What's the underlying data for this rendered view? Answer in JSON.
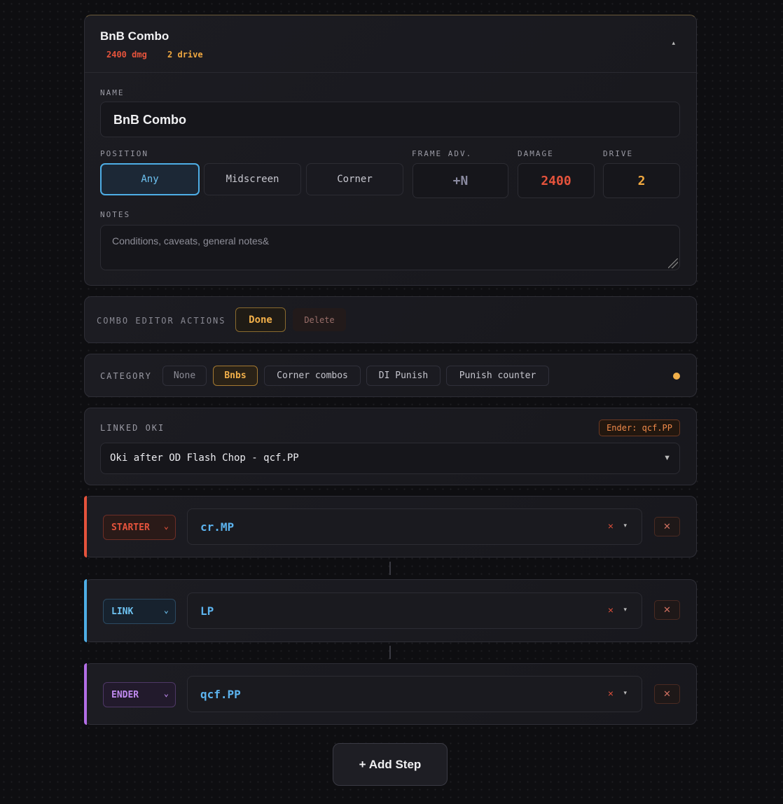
{
  "combo": {
    "title": "BnB Combo",
    "damage_stat": "2400 dmg",
    "drive_stat": "2 drive",
    "collapse_icon": "▴"
  },
  "form": {
    "name_label": "NAME",
    "name_value": "BnB Combo",
    "position_label": "POSITION",
    "positions": [
      "Any",
      "Midscreen",
      "Corner"
    ],
    "selected_position": "Any",
    "frame_adv_label": "FRAME ADV.",
    "frame_adv_value": "+N",
    "damage_label": "DAMAGE",
    "damage_value": "2400",
    "drive_label": "DRIVE",
    "drive_value": "2",
    "notes_label": "NOTES",
    "notes_placeholder": "Conditions, caveats, general notes&"
  },
  "actions": {
    "label": "COMBO EDITOR ACTIONS",
    "done": "Done",
    "delete": "Delete"
  },
  "category": {
    "label": "CATEGORY",
    "options": [
      "None",
      "Bnbs",
      "Corner combos",
      "DI Punish",
      "Punish counter"
    ],
    "selected": "Bnbs"
  },
  "oki": {
    "label": "LINKED OKI",
    "ender_badge": "Ender: qcf.PP",
    "selected": "Oki after OD Flash Chop - qcf.PP",
    "caret": "▼"
  },
  "steps": [
    {
      "type": "STARTER",
      "move": "cr.MP",
      "color": "#e5533c"
    },
    {
      "type": "LINK",
      "move": "LP",
      "color": "#4eaee6"
    },
    {
      "type": "ENDER",
      "move": "qcf.PP",
      "color": "#b36ee6"
    }
  ],
  "step_controls": {
    "chevron": "⌄",
    "clear": "×",
    "dropdown": "▾",
    "remove": "✕"
  },
  "add_step": "+ Add Step",
  "colors": {
    "accent": "#f2b04a",
    "danger": "#e5533c",
    "info": "#4eaee6",
    "ender": "#b36ee6"
  }
}
